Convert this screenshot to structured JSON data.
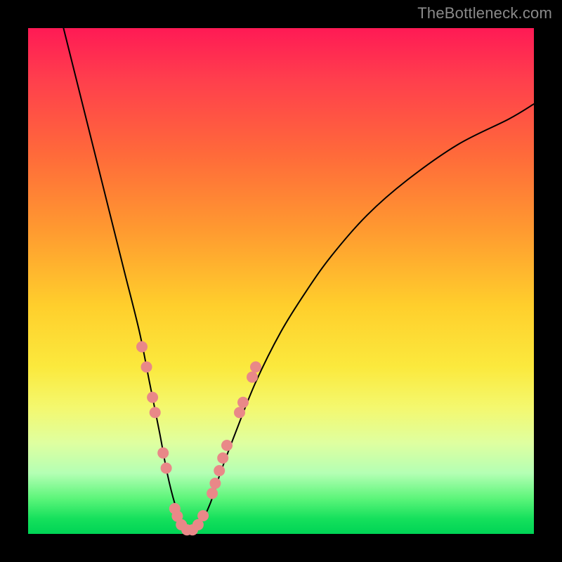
{
  "watermark": "TheBottleneck.com",
  "chart_data": {
    "type": "line",
    "title": "",
    "xlabel": "",
    "ylabel": "",
    "xlim": [
      0,
      100
    ],
    "ylim": [
      0,
      100
    ],
    "grid": false,
    "legend": false,
    "series": [
      {
        "name": "bottleneck-curve",
        "x": [
          7,
          10,
          13,
          16,
          19,
          22,
          24,
          26,
          27.5,
          29,
          30.5,
          32,
          34,
          36,
          38,
          41,
          45,
          50,
          55,
          60,
          67,
          75,
          85,
          95,
          100
        ],
        "y": [
          100,
          88,
          76,
          64,
          52,
          40,
          30,
          20,
          12,
          6,
          2,
          0.5,
          2,
          6,
          12,
          20,
          30,
          40,
          48,
          55,
          63,
          70,
          77,
          82,
          85
        ],
        "stroke": "#000000",
        "stroke_width": 2
      }
    ],
    "markers": {
      "name": "highlighted-points",
      "fill": "#e98888",
      "radius_px": 8,
      "points": [
        {
          "x": 22.5,
          "y": 37
        },
        {
          "x": 23.4,
          "y": 33
        },
        {
          "x": 24.6,
          "y": 27
        },
        {
          "x": 25.1,
          "y": 24
        },
        {
          "x": 26.7,
          "y": 16
        },
        {
          "x": 27.3,
          "y": 13
        },
        {
          "x": 29.0,
          "y": 5
        },
        {
          "x": 29.5,
          "y": 3.5
        },
        {
          "x": 30.3,
          "y": 1.8
        },
        {
          "x": 31.4,
          "y": 0.8
        },
        {
          "x": 32.5,
          "y": 0.8
        },
        {
          "x": 33.6,
          "y": 1.8
        },
        {
          "x": 34.6,
          "y": 3.6
        },
        {
          "x": 36.4,
          "y": 8
        },
        {
          "x": 37.0,
          "y": 10
        },
        {
          "x": 37.8,
          "y": 12.5
        },
        {
          "x": 38.5,
          "y": 15
        },
        {
          "x": 39.3,
          "y": 17.5
        },
        {
          "x": 41.8,
          "y": 24
        },
        {
          "x": 42.5,
          "y": 26
        },
        {
          "x": 44.3,
          "y": 31
        },
        {
          "x": 45.0,
          "y": 33
        }
      ]
    },
    "background_gradient": {
      "direction": "top-to-bottom",
      "stops": [
        {
          "pos": 0.0,
          "color": "#ff1a55"
        },
        {
          "pos": 0.55,
          "color": "#ffcf2c"
        },
        {
          "pos": 0.75,
          "color": "#f4f86e"
        },
        {
          "pos": 1.0,
          "color": "#00d455"
        }
      ]
    }
  }
}
